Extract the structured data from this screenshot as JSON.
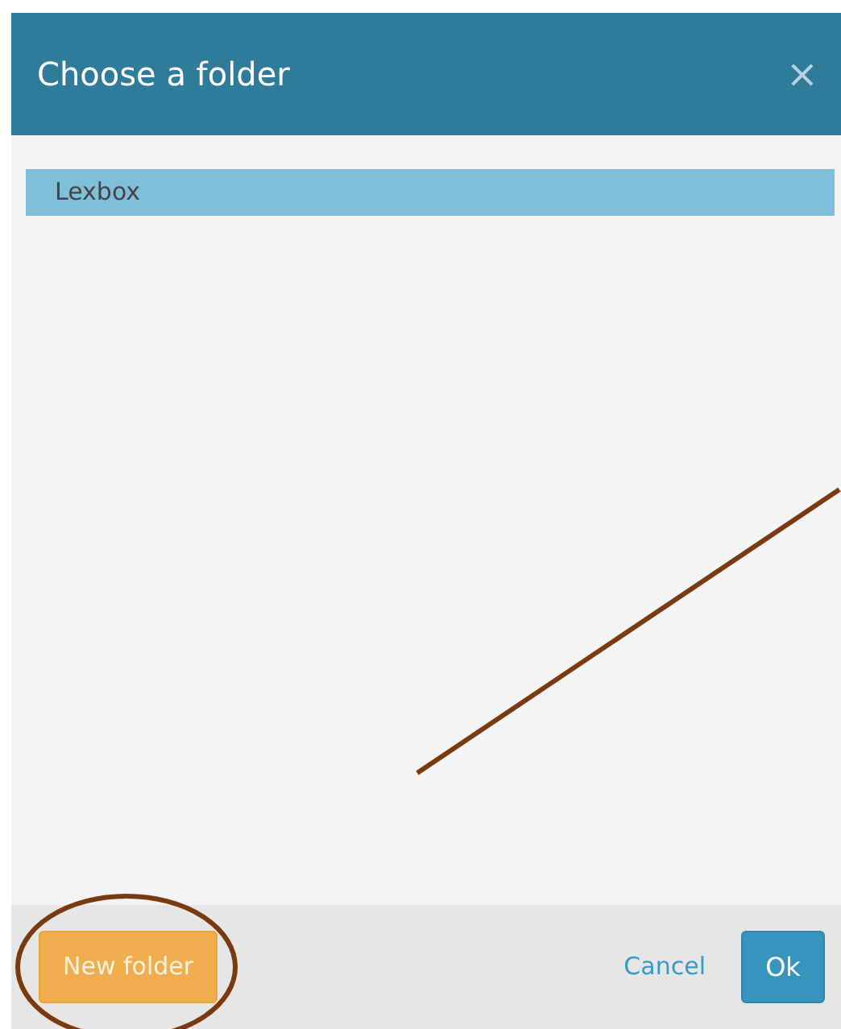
{
  "dialog": {
    "title": "Choose a folder",
    "close": "×"
  },
  "folders": [
    {
      "name": "Lexbox",
      "selected": true
    }
  ],
  "buttons": [
    {
      "kind": "secondary",
      "label": "New folder"
    },
    {
      "kind": "link",
      "label": "Cancel"
    },
    {
      "kind": "primary",
      "label": "Ok"
    }
  ],
  "annotation": {
    "pointer": true,
    "circle": true
  }
}
